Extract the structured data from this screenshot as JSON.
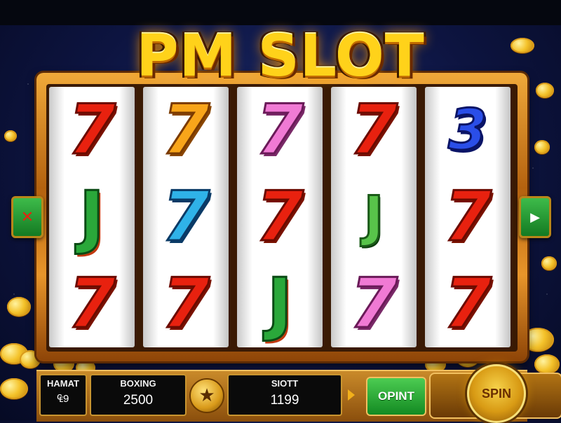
{
  "title": "PM SLOT",
  "reels": [
    {
      "symbols": [
        {
          "glyph": "7",
          "style": "s-red"
        },
        {
          "glyph": "J",
          "style": "s-green"
        },
        {
          "glyph": "7",
          "style": "s-red"
        }
      ]
    },
    {
      "symbols": [
        {
          "glyph": "7",
          "style": "s-orange"
        },
        {
          "glyph": "7",
          "style": "s-cyan"
        },
        {
          "glyph": "7",
          "style": "s-red"
        }
      ]
    },
    {
      "symbols": [
        {
          "glyph": "7",
          "style": "s-pink"
        },
        {
          "glyph": "7",
          "style": "s-red"
        },
        {
          "glyph": "J",
          "style": "s-green"
        }
      ]
    },
    {
      "symbols": [
        {
          "glyph": "7",
          "style": "s-red"
        },
        {
          "glyph": "J",
          "style": "s-dragon"
        },
        {
          "glyph": "7",
          "style": "s-pink"
        }
      ]
    },
    {
      "symbols": [
        {
          "glyph": "3",
          "style": "s-blue"
        },
        {
          "glyph": "7",
          "style": "s-red"
        },
        {
          "glyph": "7",
          "style": "s-red"
        }
      ]
    }
  ],
  "side_buttons": {
    "left_glyph": "✕",
    "right_glyph": "▶"
  },
  "panel": {
    "box1": {
      "label": "HAMAT",
      "value": "₠9"
    },
    "box2": {
      "label": "BOXING",
      "value": "2500"
    },
    "star_glyph": "★",
    "box3": {
      "label": "SIOTT",
      "value": "1199"
    },
    "opint_label": "OPINT",
    "spin_label": "SPIN"
  },
  "colors": {
    "accent_gold": "#ffd21a",
    "button_green": "#2aa83a",
    "frame_orange": "#e8952a"
  }
}
